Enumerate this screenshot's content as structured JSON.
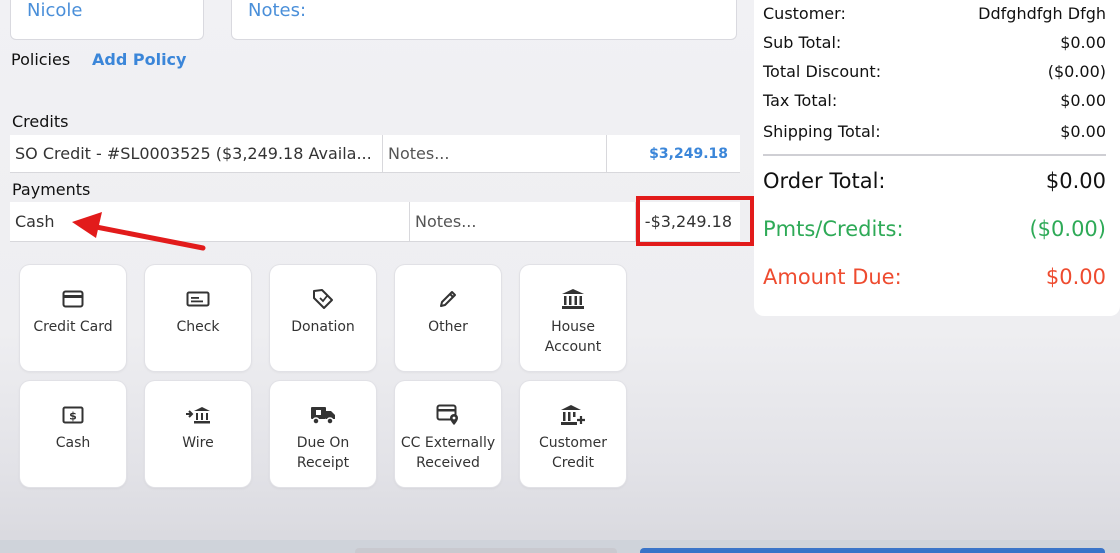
{
  "form": {
    "first_name": "Nicole",
    "notes_placeholder": "Notes:",
    "policies_label": "Policies",
    "add_policy": "Add Policy"
  },
  "credits": {
    "label": "Credits",
    "row": {
      "description": "SO Credit - #SL0003525 ($3,249.18 Availa...",
      "notes_placeholder": "Notes...",
      "amount": "$3,249.18"
    }
  },
  "payments": {
    "label": "Payments",
    "row": {
      "type": "Cash",
      "notes_placeholder": "Notes...",
      "amount": "-$3,249.18"
    }
  },
  "payment_methods": [
    {
      "label": "Credit Card",
      "icon": "credit-card-icon"
    },
    {
      "label": "Check",
      "icon": "check-icon"
    },
    {
      "label": "Donation",
      "icon": "donation-tag-icon"
    },
    {
      "label": "Other",
      "icon": "pencil-icon"
    },
    {
      "label": "House Account",
      "icon": "bank-icon"
    },
    {
      "label": "Cash",
      "icon": "cash-icon"
    },
    {
      "label": "Wire",
      "icon": "wire-transfer-icon"
    },
    {
      "label": "Due On Receipt",
      "icon": "delivery-truck-icon"
    },
    {
      "label": "CC Externally Received",
      "icon": "card-location-icon"
    },
    {
      "label": "Customer Credit",
      "icon": "bank-plus-icon"
    }
  ],
  "summary": {
    "customer_label": "Customer:",
    "customer_value": "Ddfghdfgh Dfgh",
    "subtotal_label": "Sub Total:",
    "subtotal_value": "$0.00",
    "discount_label": "Total Discount:",
    "discount_value": "($0.00)",
    "tax_label": "Tax Total:",
    "tax_value": "$0.00",
    "shipping_label": "Shipping Total:",
    "shipping_value": "$0.00",
    "order_total_label": "Order Total:",
    "order_total_value": "$0.00",
    "pmts_label": "Pmts/Credits:",
    "pmts_value": "($0.00)",
    "due_label": "Amount Due:",
    "due_value": "$0.00"
  },
  "colors": {
    "accent_blue": "#3b86d9",
    "green": "#2eaa57",
    "red": "#ee4b2f",
    "annotation_red": "#e21b1b"
  }
}
